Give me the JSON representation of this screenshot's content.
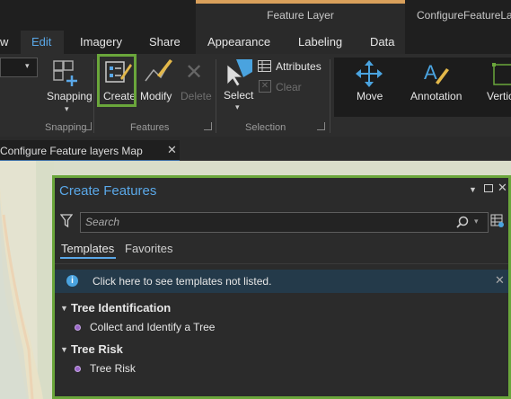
{
  "ribbon": {
    "contextual_group": "Feature Layer",
    "window_title": "ConfigureFeatureLa",
    "tabs": [
      {
        "label": "w"
      },
      {
        "label": "Edit"
      },
      {
        "label": "Imagery"
      },
      {
        "label": "Share"
      },
      {
        "label": "Appearance"
      },
      {
        "label": "Labeling"
      },
      {
        "label": "Data"
      }
    ],
    "buttons": {
      "snapping": "Snapping",
      "create": "Create",
      "modify": "Modify",
      "delete": "Delete",
      "select": "Select",
      "attributes": "Attributes",
      "clear": "Clear",
      "move": "Move",
      "annotation": "Annotation",
      "vertices": "Vertic"
    },
    "groups": {
      "snapping": "Snapping",
      "features": "Features",
      "selection": "Selection"
    }
  },
  "document": {
    "tab_label": "Configure Feature layers Map",
    "close_glyph": "✕"
  },
  "pane": {
    "title": "Create Features",
    "search": {
      "placeholder": "Search",
      "value": ""
    },
    "tabs": {
      "templates": "Templates",
      "favorites": "Favorites"
    },
    "info_text": "Click here to see templates not listed.",
    "groups": [
      {
        "name": "Tree Identification",
        "items": [
          "Collect and Identify a Tree"
        ]
      },
      {
        "name": "Tree Risk",
        "items": [
          "Tree Risk"
        ]
      }
    ]
  },
  "colors": {
    "accent": "#5aa8e8",
    "highlight": "#6aa63b",
    "contextual": "#d9a05b"
  }
}
